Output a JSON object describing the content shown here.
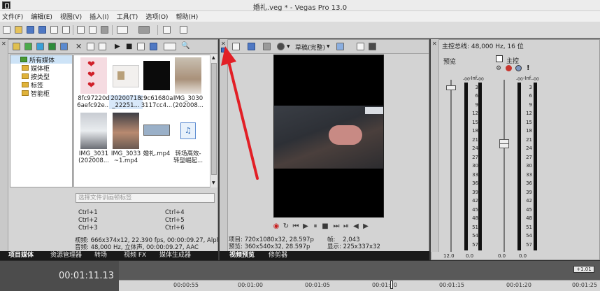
{
  "window": {
    "title": "婚礼.veg * - Vegas Pro 13.0"
  },
  "menu": [
    "文件(F)",
    "编辑(E)",
    "视图(V)",
    "插入(I)",
    "工具(T)",
    "选项(O)",
    "帮助(H)"
  ],
  "media_tree": {
    "items": [
      {
        "label": "所有媒体",
        "level": 0,
        "type": "root"
      },
      {
        "label": "媒体柜",
        "level": 1,
        "type": "folder"
      },
      {
        "label": "按类型",
        "level": 1,
        "type": "folder"
      },
      {
        "label": "标签",
        "level": 1,
        "type": "folder"
      },
      {
        "label": "智能柜",
        "level": 1,
        "type": "folder"
      }
    ]
  },
  "media_items": [
    {
      "line1": "8fc97220d",
      "line2": "6aefc92e...",
      "kind": "hearts"
    },
    {
      "line1": "20200718",
      "line2": "_22251...",
      "kind": "white"
    },
    {
      "line1": "c9c61680a",
      "line2": "3117cc4...",
      "kind": "black"
    },
    {
      "line1": "IMG_3030",
      "line2": "(202008...",
      "kind": "couple"
    },
    {
      "line1": "IMG_3031",
      "line2": "(202008...",
      "kind": "bride"
    },
    {
      "line1": "IMG_3033",
      "line2": "~1.mp4",
      "kind": "face"
    },
    {
      "line1": "婚礼.mp4",
      "line2": "",
      "kind": "media"
    },
    {
      "line1": "转场高效-",
      "line2": "转型崛起...",
      "kind": "audio"
    }
  ],
  "search": {
    "placeholder": "选择文件训画顿标签"
  },
  "hotkeys": [
    "Ctrl+1",
    "Ctrl+4",
    "Ctrl+2",
    "Ctrl+5",
    "Ctrl+3",
    "Ctrl+6"
  ],
  "media_status": {
    "video": "视频: 666x374x12, 22.390 fps, 00:00:09.27, Alpha =",
    "audio": "音频: 48,000 Hz, 立体声, 00:00:09.27, AAC"
  },
  "left_tabs": [
    "项目媒体",
    "资源管理器",
    "转场",
    "视频 FX",
    "媒体生成器"
  ],
  "preview": {
    "quality": "草稿(完整)",
    "status": {
      "project": "项目: 720x1080x32, 28.597p",
      "preview": "预览: 360x540x32, 28.597p",
      "frame": "帧:    2,043",
      "display": "显示: 225x337x32"
    }
  },
  "preview_tabs": [
    "视频预览",
    "修剪器"
  ],
  "master": {
    "header": "主控总线: 48,000 Hz, 16 位",
    "preview_label": "预览",
    "master_label": "主控",
    "scale": [
      "-Inf.",
      "3",
      "6",
      "9",
      "12",
      "15",
      "18",
      "21",
      "24",
      "27",
      "30",
      "33",
      "36",
      "39",
      "42",
      "45",
      "48",
      "51",
      "54",
      "57"
    ],
    "values": [
      "12.0",
      "0.0",
      "0.0",
      "0.0"
    ],
    "peaks": [
      "-00",
      "-00",
      "-00",
      "-00"
    ]
  },
  "timeline": {
    "timecode": "00:01:11.13",
    "rate": "+1.01",
    "ruler": [
      "00:00:55",
      "00:01:00",
      "00:01:05",
      "00:01:10",
      "00:01:15",
      "00:01:20",
      "00:01:25"
    ]
  }
}
